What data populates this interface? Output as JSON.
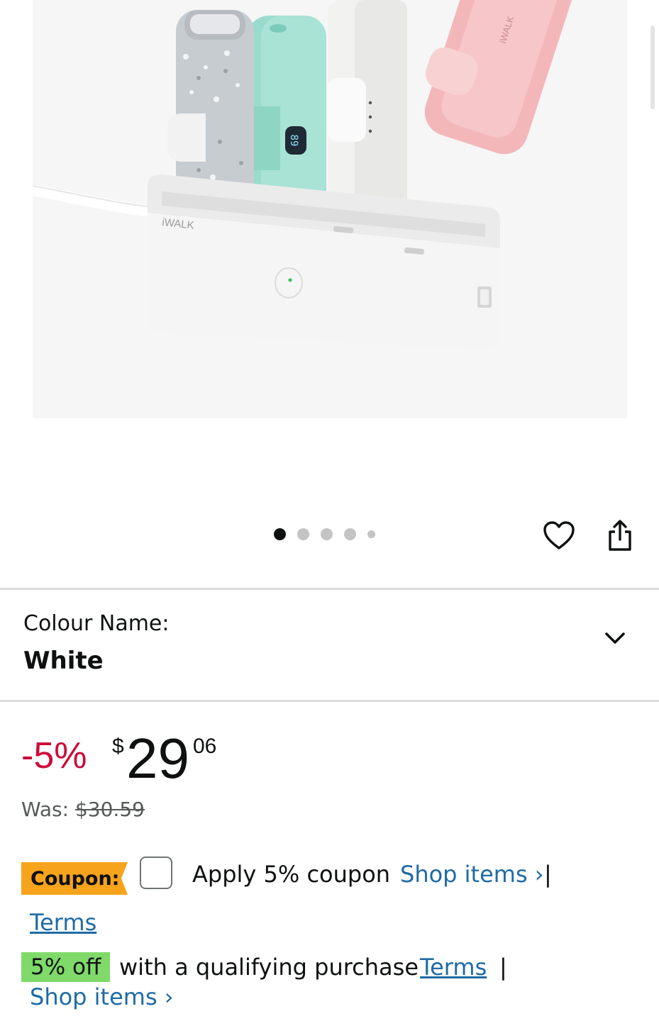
{
  "product_image": {
    "brand_text": "iWALK",
    "display_reading": "89",
    "alt_colors": [
      "#c7ccd1",
      "#99dccd",
      "#f1f1ef",
      "#f3b7ba"
    ]
  },
  "gallery": {
    "dot_count": 5,
    "active_index": 0
  },
  "colour": {
    "label": "Colour Name:",
    "value": "White"
  },
  "price": {
    "discount": "-5%",
    "currency": "$",
    "whole": "29",
    "fraction": "06",
    "was_label": "Was:",
    "was_value": "$30.59"
  },
  "coupon": {
    "tag": "Coupon:",
    "apply_text": "Apply 5% coupon",
    "shop_items": "Shop items ›",
    "separator": "|",
    "terms": "Terms"
  },
  "promo": {
    "tag": "5% off",
    "text": "with a qualifying purchase",
    "terms": "Terms",
    "separator": "|",
    "shop_items": "Shop items ›"
  },
  "colors": {
    "discount_red": "#cc0c39",
    "link_blue": "#1f6ba5",
    "coupon_orange": "#f7a31c",
    "promo_green": "#7fda69"
  }
}
